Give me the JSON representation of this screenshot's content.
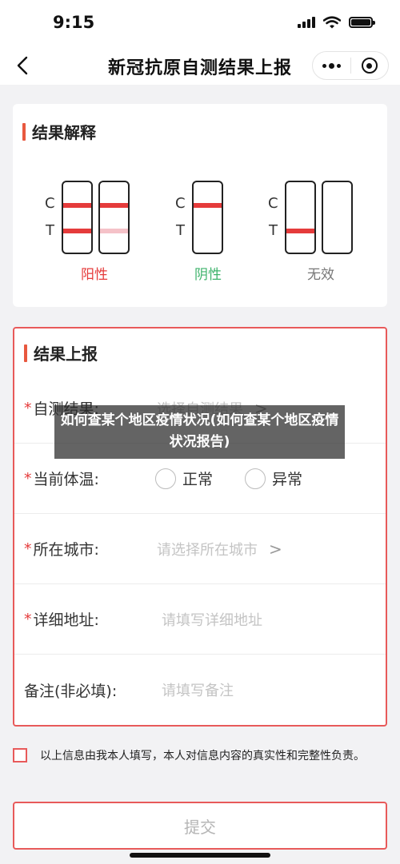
{
  "status_bar": {
    "time": "9:15"
  },
  "nav": {
    "title": "新冠抗原自测结果上报"
  },
  "result_section": {
    "heading": "结果解释",
    "letters": {
      "c": "C",
      "t": "T"
    },
    "kits": [
      {
        "label": "阳性",
        "color": "#e53b3b"
      },
      {
        "label": "阴性",
        "color": "#3db36b"
      },
      {
        "label": "无效",
        "color": "#777777"
      }
    ]
  },
  "report_section": {
    "heading": "结果上报",
    "required_mark": "*",
    "fields": {
      "result": {
        "label": "自测结果:",
        "placeholder": "选择自测结果",
        "chevron": ">"
      },
      "temperature": {
        "label": "当前体温:",
        "options": [
          "正常",
          "异常"
        ]
      },
      "city": {
        "label": "所在城市:",
        "placeholder": "请选择所在城市",
        "chevron": ">"
      },
      "address": {
        "label": "详细地址:",
        "placeholder": "请填写详细地址"
      },
      "remark": {
        "label": "备注(非必填):",
        "placeholder": "请填写备注"
      }
    }
  },
  "overlay": {
    "text": "如何查某个地区疫情状况(如何查某个地区疫情状况报告)"
  },
  "agreement": {
    "text": "以上信息由我本人填写，本人对信息内容的真实性和完整性负责。"
  },
  "submit": {
    "label": "提交"
  },
  "colors": {
    "accent": "#e85a5a",
    "positive": "#e53b3b",
    "negative": "#3db36b"
  }
}
